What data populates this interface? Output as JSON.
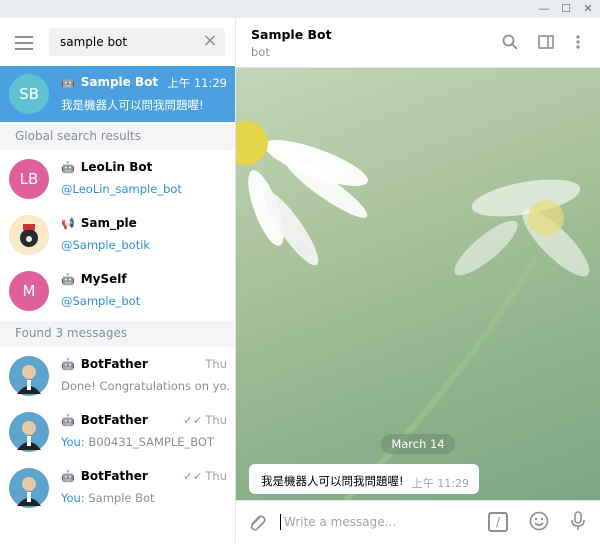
{
  "window": {
    "minimize": "—",
    "maximize": "☐",
    "close": "✕"
  },
  "sidebar": {
    "search": {
      "value": "sample bot",
      "clear_icon": "close-icon"
    },
    "active_chat": {
      "avatar": "SB",
      "avatar_color": "#5ec2d1",
      "name": "Sample Bot",
      "time": "上午 11:29",
      "preview": "我是機器人可以問我問題喔!"
    },
    "global_header": "Global search results",
    "global_results": [
      {
        "avatar": "LB",
        "avatar_color": "#e0609c",
        "name": "LeoLin Bot",
        "username": "@LeoLin_sample_bot",
        "icon": "bot-icon"
      },
      {
        "avatar": "",
        "avatar_color": "#f2d9a6",
        "name": "Sam_ple",
        "username": "@Sample_botik",
        "icon": "megaphone-icon"
      },
      {
        "avatar": "M",
        "avatar_color": "#e0609c",
        "name": "MySelf",
        "username": "@Sample_bot",
        "icon": "bot-icon"
      }
    ],
    "messages_header": "Found 3 messages",
    "messages": [
      {
        "name": "BotFather",
        "time": "Thu",
        "checked": "",
        "you": "",
        "text": "Done! Congratulations on yo..."
      },
      {
        "name": "BotFather",
        "time": "Thu",
        "checked": "✓✓",
        "you": "You:",
        "text": " B00431_SAMPLE_BOT"
      },
      {
        "name": "BotFather",
        "time": "Thu",
        "checked": "✓✓",
        "you": "You:",
        "text": " Sample Bot"
      }
    ]
  },
  "chat": {
    "title": "Sample Bot",
    "status": "bot",
    "date": "March 14",
    "message": {
      "text": "我是機器人可以問我問題喔!",
      "time": "上午 11:29"
    },
    "placeholder": "Write a message...",
    "command_label": "/"
  }
}
